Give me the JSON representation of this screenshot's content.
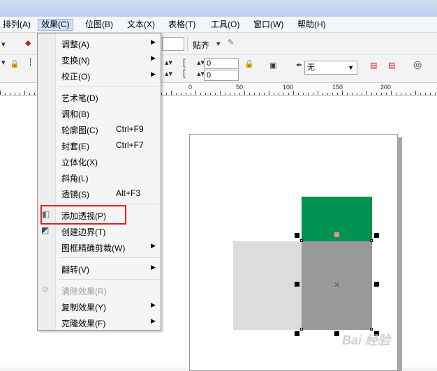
{
  "menubar": {
    "items": [
      "排列(A)",
      "效果(C)",
      "位图(B)",
      "文本(X)",
      "表格(T)",
      "工具(O)",
      "窗口(W)",
      "帮助(H)"
    ]
  },
  "toolbar": {
    "snap_label": "贴齐",
    "offset_x": "0",
    "offset_y": "0",
    "outline_value": "无"
  },
  "ruler": {
    "labels": [
      "0",
      "50",
      "100",
      "150",
      "200"
    ]
  },
  "effects_menu": {
    "items": [
      {
        "label": "调整(A)",
        "shortcut": "",
        "submenu": true
      },
      {
        "label": "变换(N)",
        "shortcut": "",
        "submenu": true
      },
      {
        "label": "校正(O)",
        "shortcut": "",
        "submenu": true
      },
      {
        "label": "艺术笔(D)",
        "shortcut": "",
        "submenu": false
      },
      {
        "label": "调和(B)",
        "shortcut": "",
        "submenu": false
      },
      {
        "label": "轮廓图(C)",
        "shortcut": "Ctrl+F9",
        "submenu": false
      },
      {
        "label": "封套(E)",
        "shortcut": "Ctrl+F7",
        "submenu": false
      },
      {
        "label": "立体化(X)",
        "shortcut": "",
        "submenu": false
      },
      {
        "label": "斜角(L)",
        "shortcut": "",
        "submenu": false
      },
      {
        "label": "透镜(S)",
        "shortcut": "Alt+F3",
        "submenu": false
      },
      {
        "label": "添加透视(P)",
        "shortcut": "",
        "submenu": false
      },
      {
        "label": "创建边界(T)",
        "shortcut": "",
        "submenu": false
      },
      {
        "label": "图框精确剪裁(W)",
        "shortcut": "",
        "submenu": true
      },
      {
        "label": "翻转(V)",
        "shortcut": "",
        "submenu": true
      },
      {
        "label": "清除效果(R)",
        "shortcut": "",
        "submenu": false,
        "disabled": true
      },
      {
        "label": "复制效果(Y)",
        "shortcut": "",
        "submenu": true
      },
      {
        "label": "克隆效果(F)",
        "shortcut": "",
        "submenu": true
      }
    ]
  },
  "colors": {
    "green_rect": "#00924f",
    "light_gray_rect": "#dcdcdc",
    "gray_rect": "#999999",
    "highlight": "#e02020"
  },
  "watermark": "Bai 经验"
}
